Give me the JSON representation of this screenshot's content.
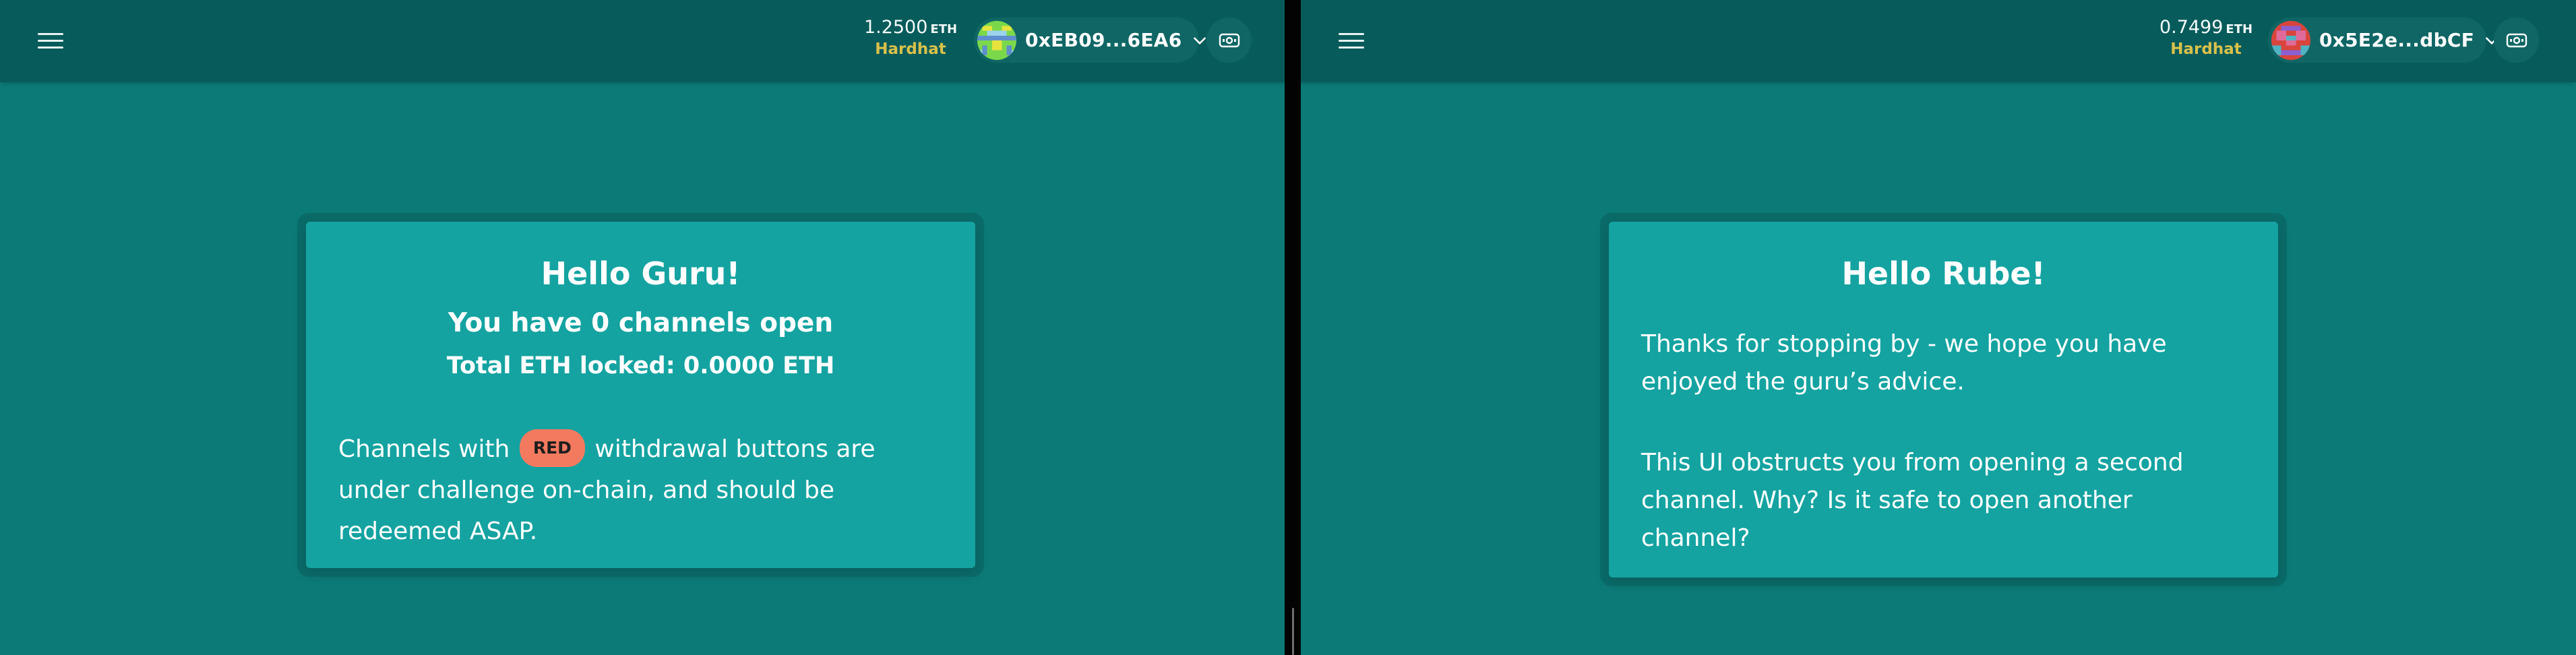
{
  "left": {
    "header": {
      "balance_amount": "1.2500",
      "balance_unit": "ETH",
      "network": "Hardhat",
      "account_address": "0xEB09...6EA6"
    },
    "card": {
      "greeting": "Hello Guru!",
      "channels_open": "You have 0 channels open",
      "total_locked": "Total ETH locked: 0.0000 ETH",
      "note_before": "Channels with",
      "badge_label": "RED",
      "note_after": "withdrawal buttons are under challenge on-chain, and should be redeemed ASAP."
    }
  },
  "right": {
    "header": {
      "balance_amount": "0.7499",
      "balance_unit": "ETH",
      "network": "Hardhat",
      "account_address": "0x5E2e...dbCF"
    },
    "card": {
      "greeting": "Hello Rube!",
      "paragraph1": "Thanks for stopping by - we hope you have enjoyed the guru’s advice.",
      "paragraph2": "This UI obstructs you from opening a second channel. Why? Is it safe to open another channel?"
    }
  },
  "colors": {
    "page_bg": "#0c7a77",
    "header_bg": "#085b5b",
    "card_bg": "#14a3a1",
    "network_label": "#d9c14a",
    "red_badge": "#f47a5f",
    "pill_bg": "#0f6665"
  },
  "icons": [
    "hamburger-menu-icon",
    "identicon-avatar",
    "chevron-down-icon",
    "qr-code-icon"
  ]
}
